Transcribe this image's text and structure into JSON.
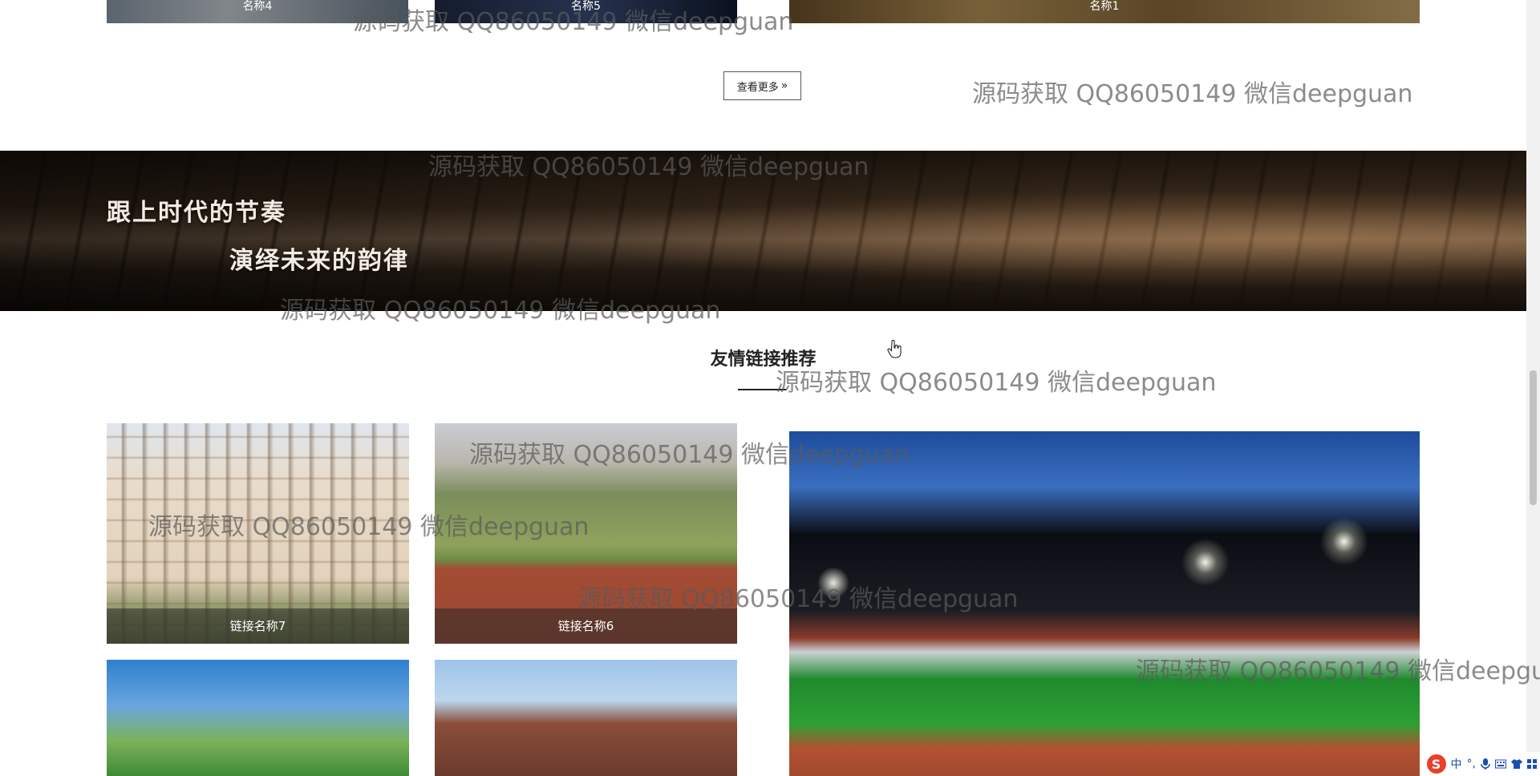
{
  "top_cards": [
    {
      "caption": "名称4"
    },
    {
      "caption": "名称5"
    },
    {
      "caption": "名称1"
    }
  ],
  "more_button": {
    "label": "查看更多",
    "icon": "double-chevron-right-icon"
  },
  "banner": {
    "line1": "跟上时代的节奏",
    "line2": "演绎未来的韵律"
  },
  "links_section": {
    "title": "友情链接推荐",
    "items": [
      {
        "caption": "链接名称7"
      },
      {
        "caption": "链接名称6"
      }
    ]
  },
  "watermark_text": "源码获取 QQ86050149 微信deepguan",
  "ime_toolbar": {
    "logo": "S",
    "mode": "中",
    "punct": "°,",
    "icons": [
      "microphone-icon",
      "keyboard-icon",
      "shirt-icon",
      "grid-icon"
    ]
  }
}
